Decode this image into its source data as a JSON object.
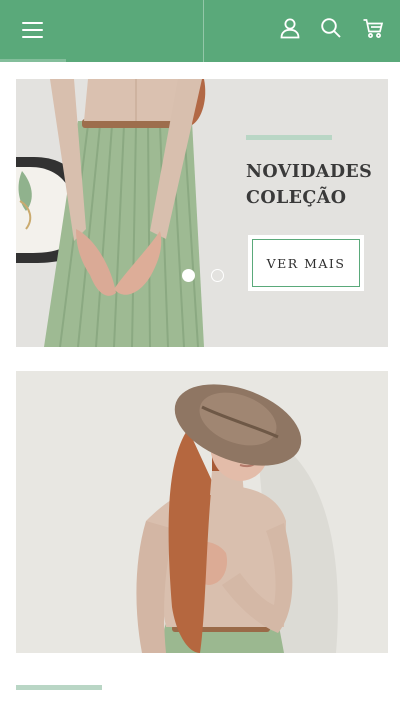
{
  "header": {
    "menu_icon": "hamburger-menu-icon",
    "account_icon": "user-icon",
    "search_icon": "search-icon",
    "cart_icon": "cart-icon",
    "accent": "#5aa97a"
  },
  "carousel": {
    "title_line1": "NOVIDADES",
    "title_line2": "COLEÇÃO",
    "button_label": "VER MAIS",
    "slides": 2,
    "active_slide": 1
  },
  "colors": {
    "accent_light": "#b9d6c5",
    "text_dark": "#3a3a3a"
  }
}
